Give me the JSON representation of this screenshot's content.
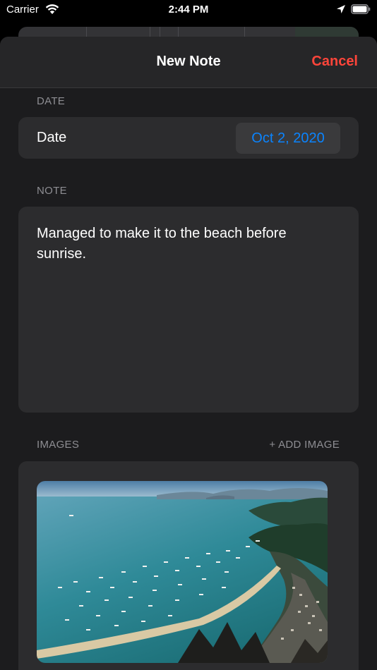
{
  "status_bar": {
    "carrier": "Carrier",
    "time": "2:44 PM"
  },
  "nav": {
    "title": "New Note",
    "cancel_label": "Cancel"
  },
  "date_section": {
    "header": "DATE",
    "label": "Date",
    "value": "Oct 2, 2020"
  },
  "note_section": {
    "header": "NOTE",
    "text": "Managed to make it to the beach before sunrise."
  },
  "images_section": {
    "header": "IMAGES",
    "add_label": "+ ADD IMAGE",
    "images": [
      {
        "description_icon": "photo-image"
      }
    ]
  },
  "colors": {
    "accent": "#0a84ff",
    "destructive": "#ff453a",
    "background": "#1c1c1e",
    "cell": "#2c2c2e",
    "secondary_text": "#8e8e93"
  }
}
